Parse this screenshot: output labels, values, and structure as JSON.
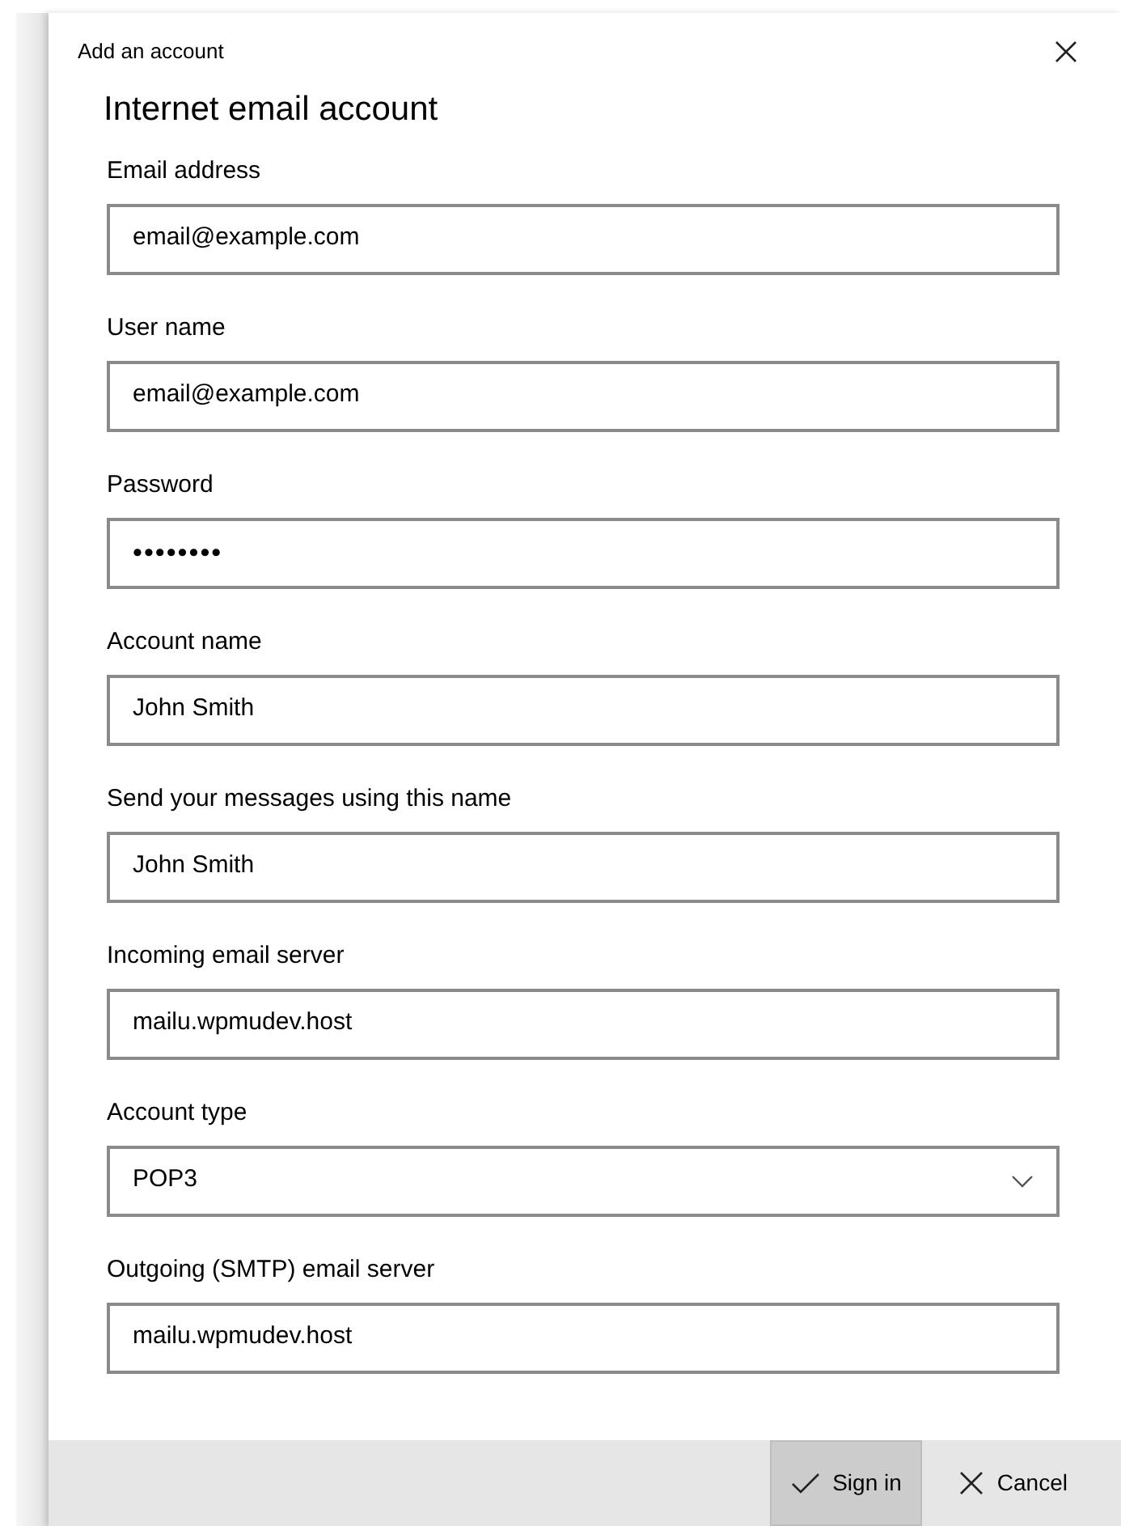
{
  "window": {
    "title": "Add an account"
  },
  "heading": "Internet email account",
  "fields": [
    {
      "label": "Email address",
      "kind": "text",
      "value": "email@example.com"
    },
    {
      "label": "User name",
      "kind": "text",
      "value": "email@example.com"
    },
    {
      "label": "Password",
      "kind": "password",
      "value": "••••••••"
    },
    {
      "label": "Account name",
      "kind": "text",
      "value": "John Smith"
    },
    {
      "label": "Send your messages using this name",
      "kind": "text",
      "value": "John Smith"
    },
    {
      "label": "Incoming email server",
      "kind": "text",
      "value": "mailu.wpmudev.host"
    },
    {
      "label": "Account type",
      "kind": "select",
      "value": "POP3"
    },
    {
      "label": "Outgoing (SMTP) email server",
      "kind": "text",
      "value": "mailu.wpmudev.host"
    }
  ],
  "buttons": [
    {
      "label": "Sign in",
      "kind": "confirm",
      "hovered": true
    },
    {
      "label": "Cancel",
      "kind": "cancel",
      "hovered": false
    }
  ]
}
